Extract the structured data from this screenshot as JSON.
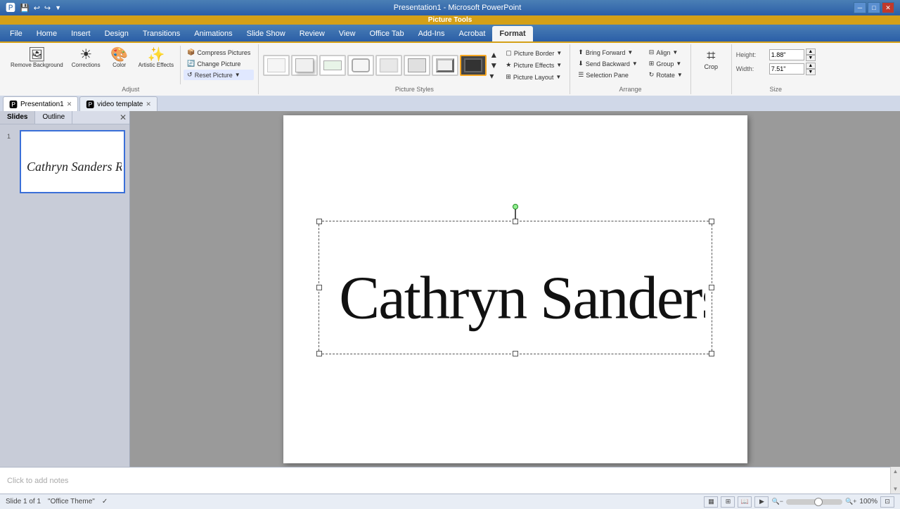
{
  "titleBar": {
    "title": "Presentation1 - Microsoft PowerPoint",
    "pictureToolsLabel": "Picture Tools",
    "windowControls": [
      "─",
      "□",
      "✕"
    ]
  },
  "quickAccess": {
    "buttons": [
      "💾",
      "↩",
      "↪",
      "▼"
    ]
  },
  "ribbon": {
    "pictureToolsLabel": "Picture Tools",
    "tabs": [
      {
        "label": "File",
        "active": false
      },
      {
        "label": "Home",
        "active": false
      },
      {
        "label": "Insert",
        "active": false
      },
      {
        "label": "Design",
        "active": false
      },
      {
        "label": "Transitions",
        "active": false
      },
      {
        "label": "Animations",
        "active": false
      },
      {
        "label": "Slide Show",
        "active": false
      },
      {
        "label": "Review",
        "active": false
      },
      {
        "label": "View",
        "active": false
      },
      {
        "label": "Office Tab",
        "active": false
      },
      {
        "label": "Add-Ins",
        "active": false
      },
      {
        "label": "Acrobat",
        "active": false
      },
      {
        "label": "Format",
        "active": true
      }
    ],
    "adjustGroup": {
      "label": "Adjust",
      "removeBackground": "Remove\nBackground",
      "corrections": "Corrections",
      "color": "Color",
      "artisticEffects": "Artistic\nEffects",
      "compressPictures": "Compress Pictures",
      "changePicture": "Change Picture",
      "resetPicture": "Reset Picture"
    },
    "pictureStylesGroup": {
      "label": "Picture Styles",
      "styles": [
        "simple",
        "shadow",
        "reflected",
        "rounded",
        "soft",
        "center",
        "beveled",
        "dark"
      ],
      "pictureBorder": "Picture Border",
      "pictureEffects": "Picture Effects",
      "pictureLayout": "Picture Layout"
    },
    "arrangeGroup": {
      "label": "Arrange",
      "bringForward": "Bring Forward",
      "sendBackward": "Send Backward",
      "selectionPane": "Selection Pane",
      "align": "Align",
      "group": "Group",
      "rotate": "Rotate"
    },
    "cropGroup": {
      "label": "",
      "crop": "Crop"
    },
    "sizeGroup": {
      "label": "Size",
      "heightLabel": "Height:",
      "heightValue": "1.88\"",
      "widthLabel": "Width:",
      "widthValue": "7.51\""
    }
  },
  "docTabs": [
    {
      "label": "Presentation1",
      "active": true
    },
    {
      "label": "video template",
      "active": false
    }
  ],
  "slideTabs": [
    {
      "label": "Slides",
      "active": true
    },
    {
      "label": "Outline",
      "active": false
    }
  ],
  "slideThumb": {
    "number": "1",
    "content": "Cathryn Sanders Road"
  },
  "slide": {
    "signatureText": "Cathryn Sanders Road"
  },
  "notes": {
    "placeholder": "Click to add notes"
  },
  "statusBar": {
    "slideInfo": "Slide 1 of 1",
    "theme": "\"Office Theme\"",
    "zoomPercent": "100%"
  }
}
